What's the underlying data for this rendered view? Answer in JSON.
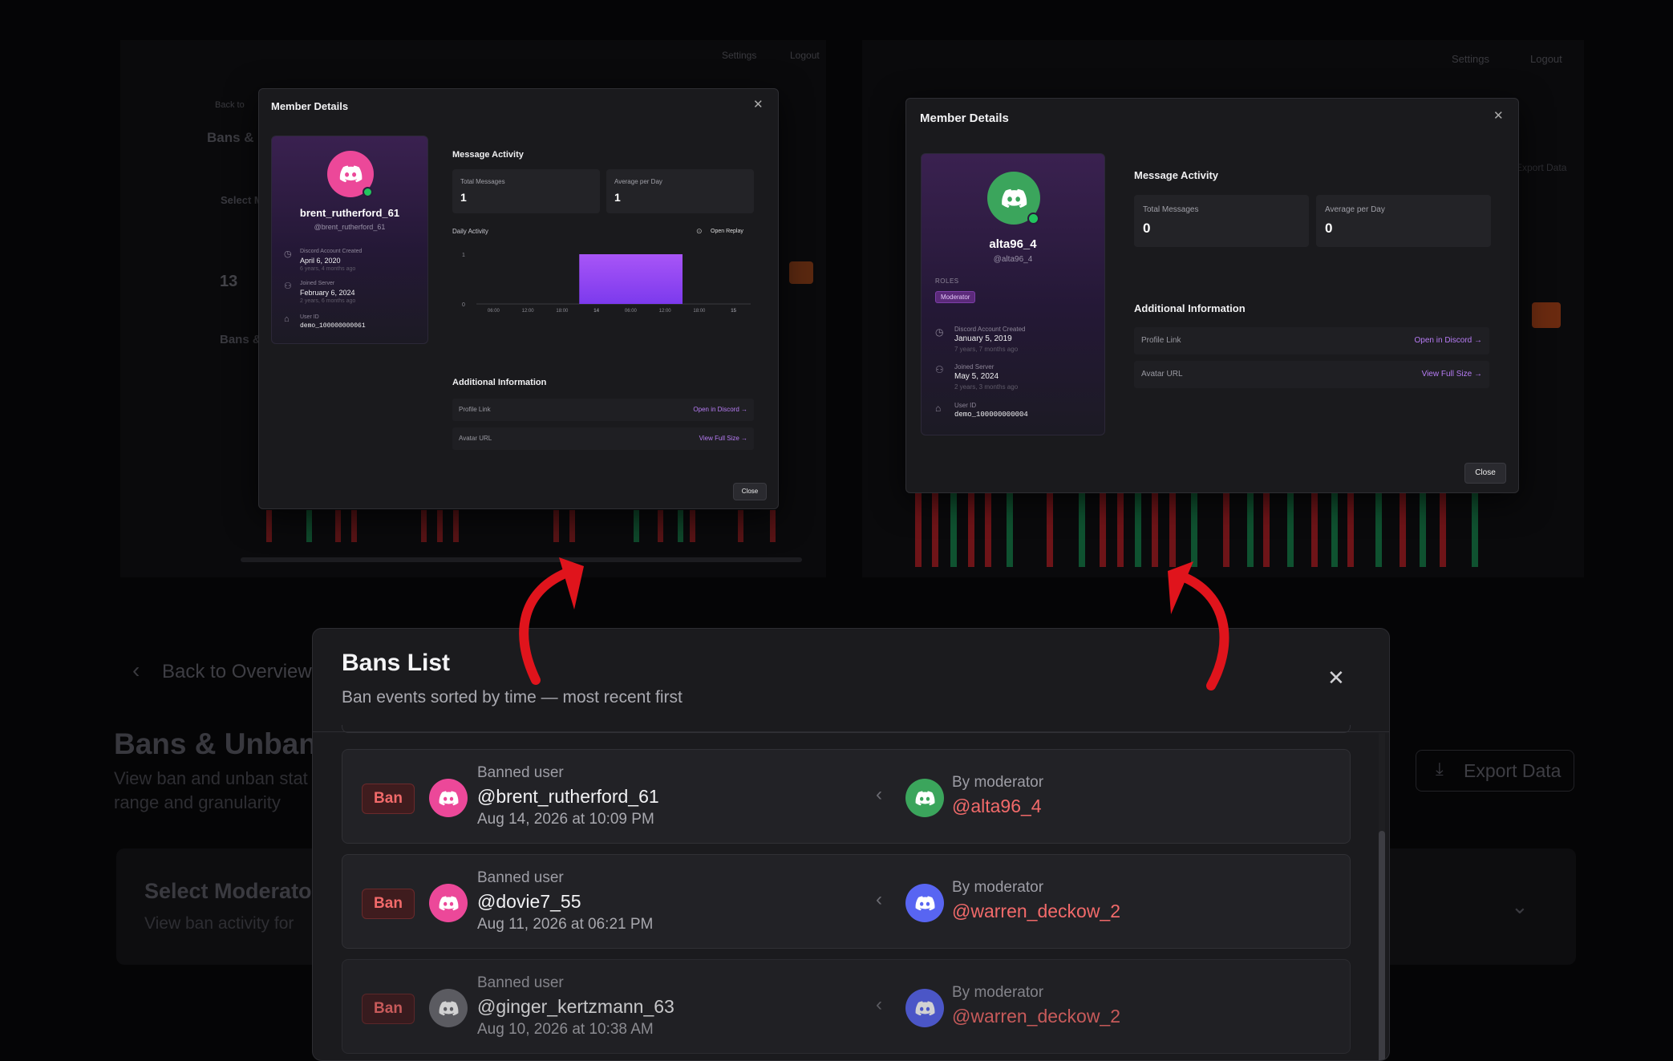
{
  "bg_left": {
    "nav_settings": "Settings",
    "nav_logout": "Logout",
    "back": "Back to",
    "title": "Bans & U",
    "select": "Select M",
    "total_value": "13",
    "bans_title": "Bans &"
  },
  "bg_right": {
    "nav_settings": "Settings",
    "nav_logout": "Logout",
    "export": "Export Data"
  },
  "bg_bottom": {
    "back": "Back to Overview",
    "title": "Bans & Unban",
    "desc_line1": "View ban and unban stat",
    "desc_line2": "range and granularity",
    "select_title": "Select Moderato",
    "select_desc": "View ban activity for",
    "export": "Export Data"
  },
  "modal1": {
    "title": "Member Details",
    "username": "brent_rutherford_61",
    "handle": "@brent_rutherford_61",
    "created_label": "Discord Account Created",
    "created_value": "April 6, 2020",
    "created_ago": "6 years, 4 months ago",
    "joined_label": "Joined Server",
    "joined_value": "February 6, 2024",
    "joined_ago": "2 years, 6 months ago",
    "userid_label": "User ID",
    "userid_value": "demo_100000000061",
    "activity_title": "Message Activity",
    "total_label": "Total Messages",
    "total_value": "1",
    "avg_label": "Average per Day",
    "avg_value": "1",
    "daily_label": "Daily Activity",
    "replay_label": "Open Replay",
    "chart_ticks": [
      "06:00",
      "12:00",
      "18:00",
      "14",
      "06:00",
      "12:00",
      "18:00",
      "15"
    ],
    "chart_y": [
      "1",
      "0"
    ],
    "additional_title": "Additional Information",
    "profile_link_label": "Profile Link",
    "profile_link_value": "Open in Discord →",
    "avatar_url_label": "Avatar URL",
    "avatar_url_value": "View Full Size →",
    "close_label": "Close"
  },
  "modal2": {
    "title": "Member Details",
    "username": "alta96_4",
    "handle": "@alta96_4",
    "roles_label": "ROLES",
    "role": "Moderator",
    "created_label": "Discord Account Created",
    "created_value": "January 5, 2019",
    "created_ago": "7 years, 7 months ago",
    "joined_label": "Joined Server",
    "joined_value": "May 5, 2024",
    "joined_ago": "2 years, 3 months ago",
    "userid_label": "User ID",
    "userid_value": "demo_100000000004",
    "activity_title": "Message Activity",
    "total_label": "Total Messages",
    "total_value": "0",
    "avg_label": "Average per Day",
    "avg_value": "0",
    "additional_title": "Additional Information",
    "profile_link_label": "Profile Link",
    "profile_link_value": "Open in Discord →",
    "avatar_url_label": "Avatar URL",
    "avatar_url_value": "View Full Size →",
    "close_label": "Close"
  },
  "chart_data": {
    "type": "bar",
    "categories": [
      "06:00",
      "12:00",
      "18:00",
      "14",
      "06:00",
      "12:00",
      "18:00",
      "15"
    ],
    "values": [
      0,
      0,
      0,
      1,
      1,
      1,
      0,
      0
    ],
    "title": "Daily Activity",
    "ylim": [
      0,
      1
    ]
  },
  "bans_list": {
    "title": "Bans List",
    "subtitle": "Ban events sorted by time — most recent first",
    "banned_label": "Banned user",
    "by_label": "By moderator",
    "badge": "Ban",
    "items": [
      {
        "user": "@brent_rutherford_61",
        "date": "Aug 14, 2026 at 10:09 PM",
        "moderator": "@alta96_4"
      },
      {
        "user": "@dovie7_55",
        "date": "Aug 11, 2026 at 06:21 PM",
        "moderator": "@warren_deckow_2"
      },
      {
        "user": "@ginger_kertzmann_63",
        "date": "Aug 10, 2026 at 10:38 AM",
        "moderator": "@warren_deckow_2"
      }
    ]
  },
  "colors": {
    "accent": "#b77cf5",
    "ban_red": "#f26a6a",
    "arrow_red": "#e0141c",
    "avatar_pink": "#ec4899",
    "avatar_green": "#3ba55c",
    "avatar_blurple": "#5865f2",
    "avatar_gray": "#6b6b72"
  }
}
